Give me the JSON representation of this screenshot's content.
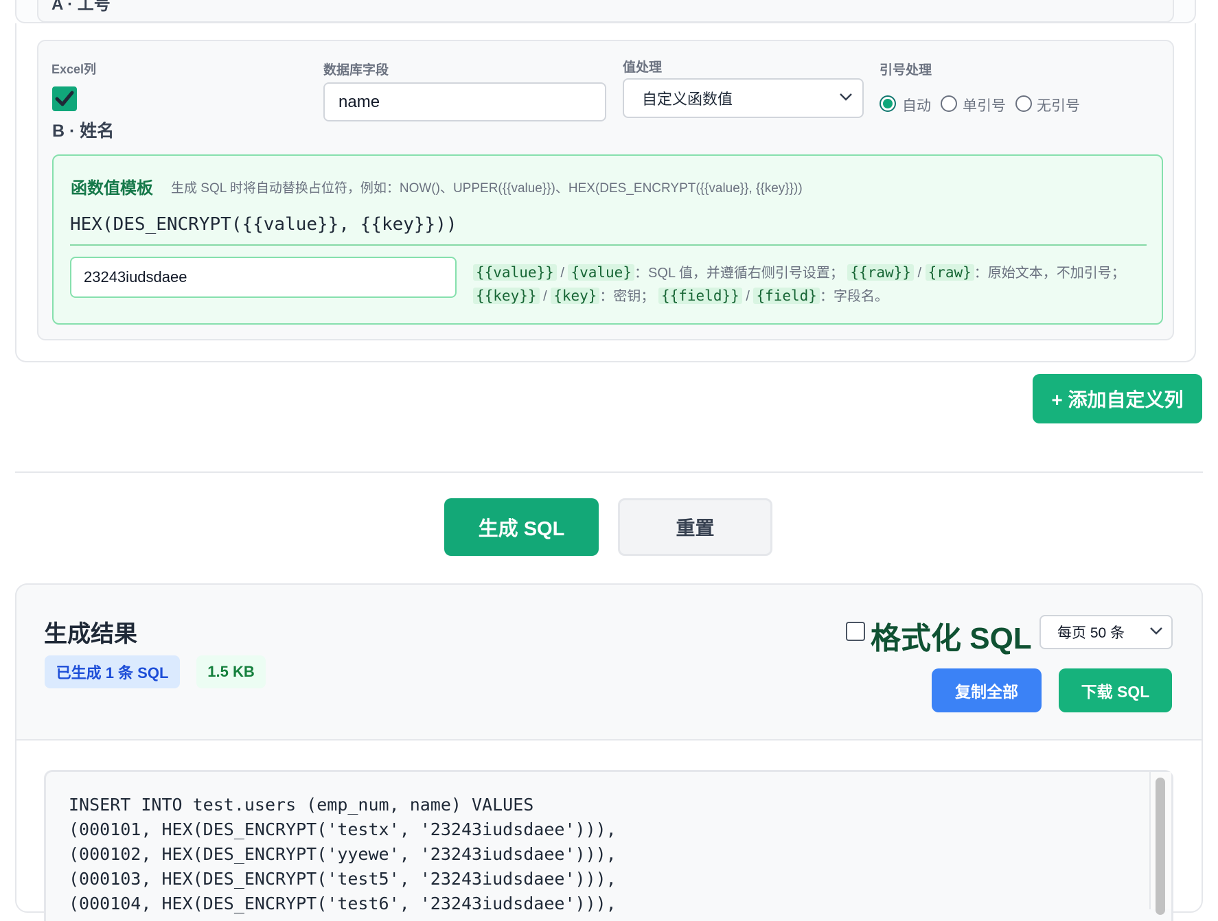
{
  "top_section": {
    "cut_text": "A · 工号"
  },
  "mapping": {
    "excel_col_label": "Excel列",
    "column_name": "B · 姓名",
    "checked": true,
    "db_field_label": "数据库字段",
    "db_field_value": "name",
    "value_proc_label": "值处理",
    "value_proc_selected": "自定义函数值",
    "quote_label": "引号处理",
    "quote_options": [
      "自动",
      "单引号",
      "无引号"
    ],
    "quote_selected": "自动"
  },
  "fn_template": {
    "title": "函数值模板",
    "hint": "生成 SQL 时将自动替换占位符，例如：NOW()、UPPER({{value}})、HEX(DES_ENCRYPT({{value}}, {{key}}))",
    "template": "HEX(DES_ENCRYPT({{value}}, {{key}}))",
    "key_value": "23243iudsdaee",
    "help": {
      "t1": "{{value}}",
      "sep1": " / ",
      "t2": "{value}",
      "d1": "：SQL 值，并遵循右侧引号设置；",
      "t3": "{{raw}}",
      "sep2": " / ",
      "t4": "{raw}",
      "d2": "：原始文本，不加引号；",
      "t5": "{{key}}",
      "sep3": " / ",
      "t6": "{key}",
      "d3": "：密钥；",
      "t7": "{{field}}",
      "sep4": " / ",
      "t8": "{field}",
      "d4": "：字段名。"
    }
  },
  "buttons": {
    "add_column": "+ 添加自定义列",
    "generate": "生成 SQL",
    "reset": "重置",
    "copy_all": "复制全部",
    "download": "下载 SQL"
  },
  "result": {
    "title": "生成结果",
    "count_badge": "已生成 1 条 SQL",
    "size_badge": "1.5 KB",
    "format_label": "格式化 SQL",
    "format_checked": false,
    "page_size": "每页 50 条",
    "sql_lines": [
      "INSERT INTO test.users (emp_num, name) VALUES",
      "(000101, HEX(DES_ENCRYPT('testx', '23243iudsdaee'))),",
      "(000102, HEX(DES_ENCRYPT('yyewe', '23243iudsdaee'))),",
      "(000103, HEX(DES_ENCRYPT('test5', '23243iudsdaee'))),",
      "(000104, HEX(DES_ENCRYPT('test6', '23243iudsdaee'))),"
    ]
  },
  "colors": {
    "primary_green": "#13a877",
    "blue": "#3b82f6",
    "fn_box_bg": "#eefcf3"
  }
}
